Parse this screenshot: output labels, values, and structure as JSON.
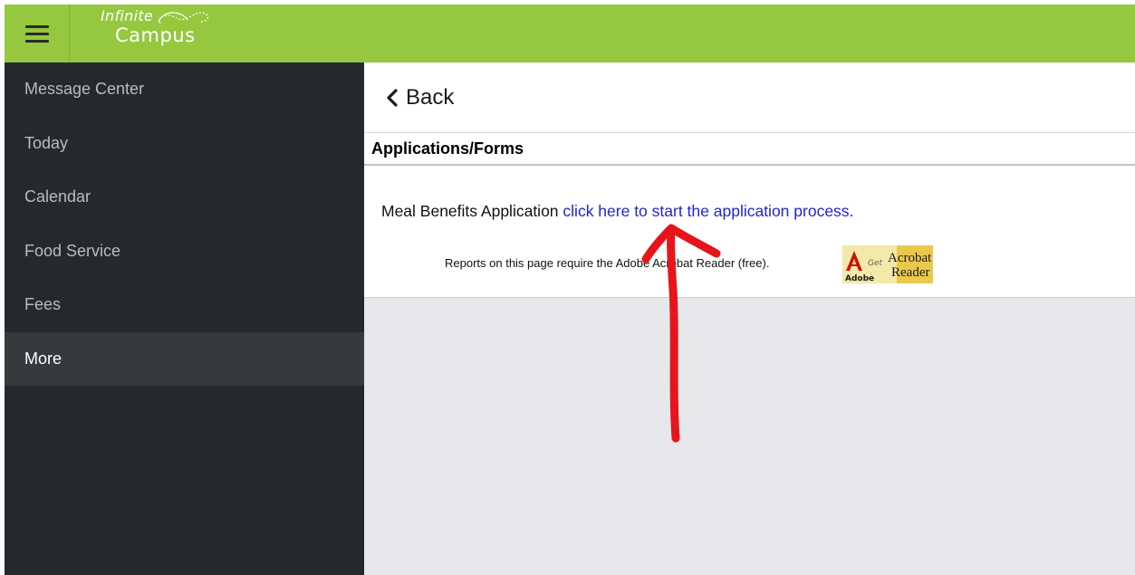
{
  "app": {
    "logo_line1": "Infinite",
    "logo_line2": "Campus"
  },
  "sidebar": {
    "items": [
      {
        "label": "Message Center",
        "active": false
      },
      {
        "label": "Today",
        "active": false
      },
      {
        "label": "Calendar",
        "active": false
      },
      {
        "label": "Food Service",
        "active": false
      },
      {
        "label": "Fees",
        "active": false
      },
      {
        "label": "More",
        "active": true
      }
    ]
  },
  "main": {
    "back_label": "Back",
    "section_title": "Applications/Forms",
    "meal_label": "Meal Benefits Application",
    "meal_link": "click here to start the application process.",
    "reports_note": "Reports on this page require the Adobe Acrobat Reader (free).",
    "acrobat_badge": {
      "brand": "Adobe",
      "get": "Get",
      "line1": "Acrobat",
      "line2": "Reader"
    }
  },
  "colors": {
    "topbar": "#95c83f",
    "sidebar": "#25292c",
    "sidebar_active": "#363a3d",
    "link": "#2323d6",
    "annotation": "#e8141b"
  },
  "icons": {
    "menu": "hamburger-icon",
    "back": "chevron-left-icon",
    "logo_swoosh": "infinity-swoosh-icon"
  }
}
